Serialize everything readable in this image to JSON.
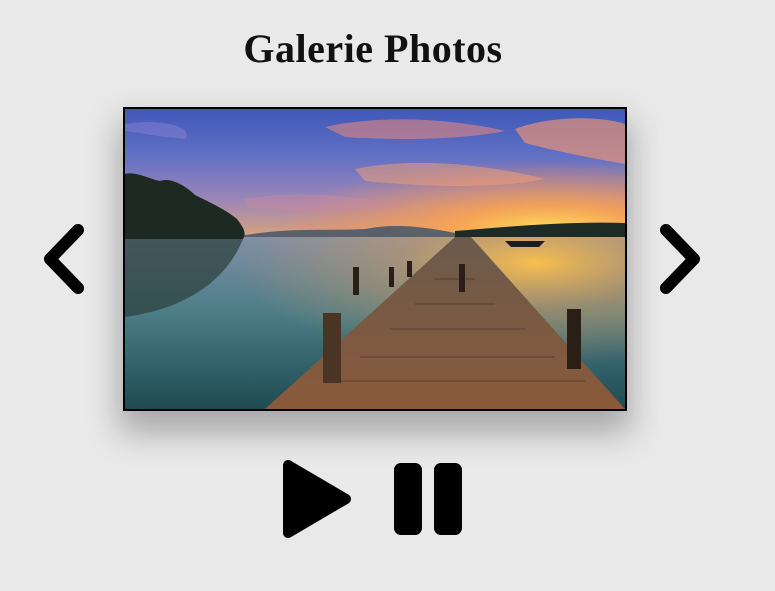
{
  "header": {
    "title": "Galerie Photos"
  },
  "gallery": {
    "current_image": "lake-pier-sunset-photo"
  },
  "navigation": {
    "prev_icon": "chevron-left-icon",
    "next_icon": "chevron-right-icon"
  },
  "controls": {
    "play_icon": "play-icon",
    "pause_icon": "pause-icon"
  },
  "colors": {
    "background": "#e9e9e9",
    "icon": "#000000",
    "title": "#111111"
  }
}
